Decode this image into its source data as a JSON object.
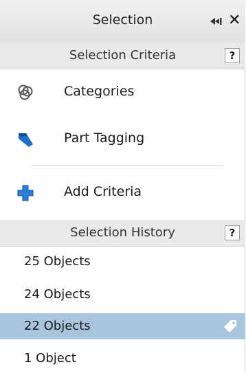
{
  "panel": {
    "title": "Selection",
    "close_glyph": "✕"
  },
  "criteria": {
    "header": "Selection Criteria",
    "help_label": "?",
    "items": [
      {
        "label": "Categories",
        "icon": "categories-icon"
      },
      {
        "label": "Part Tagging",
        "icon": "tag-icon"
      }
    ],
    "add_label": "Add Criteria"
  },
  "history": {
    "header": "Selection History",
    "help_label": "?",
    "rows": [
      {
        "label": "25 Objects",
        "selected": false
      },
      {
        "label": "24 Objects",
        "selected": false
      },
      {
        "label": "22 Objects",
        "selected": true
      },
      {
        "label": "1 Object",
        "selected": false
      }
    ]
  },
  "colors": {
    "selected_row": "#a9c4dd",
    "accent_blue": "#1f6fc7"
  }
}
